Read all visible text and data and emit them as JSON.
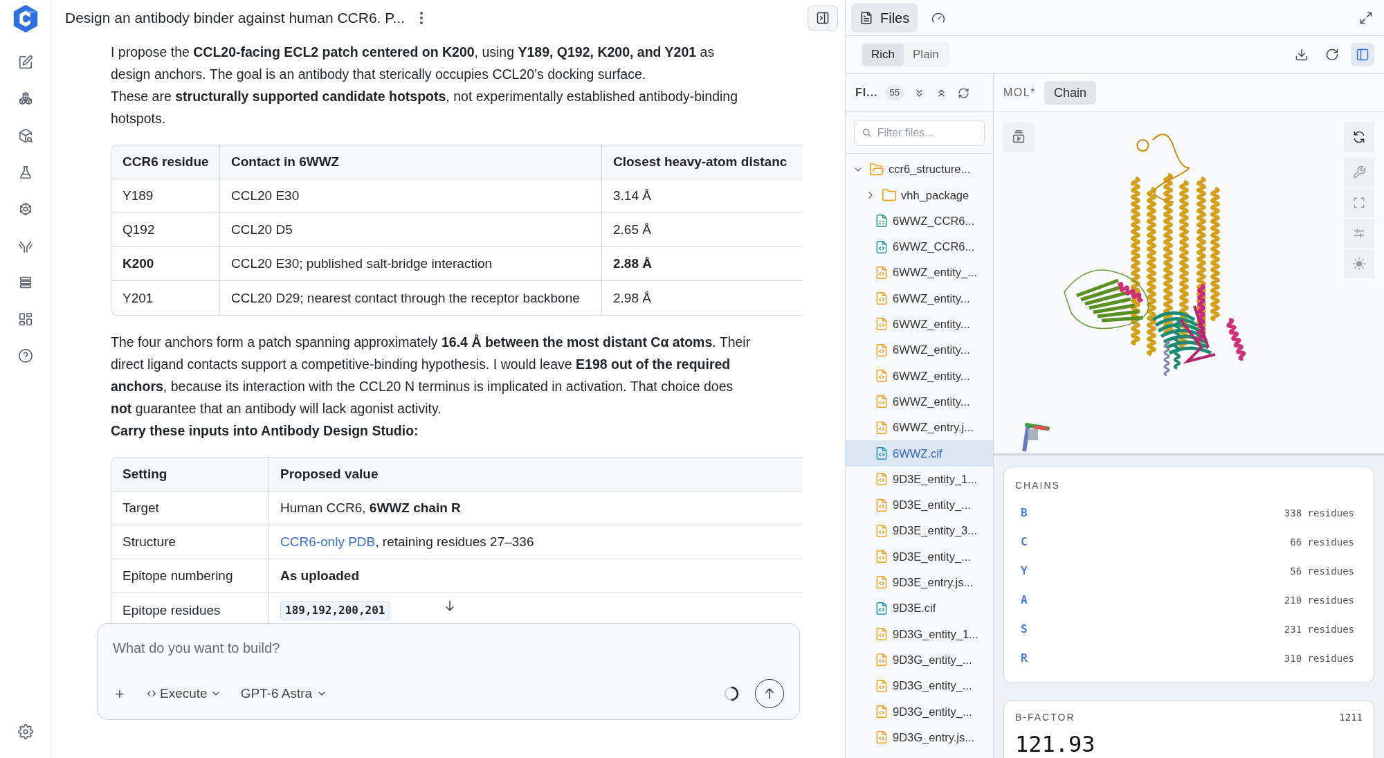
{
  "chat": {
    "title": "Design an antibody binder against human CCR6. P...",
    "intro": [
      "I propose the **CCL20-facing ECL2 patch centered on K200**, using **Y189, Q192, K200, and Y201** as design anchors. The goal is an antibody that sterically occupies CCL20’s docking surface.",
      "These are **structurally supported candidate hotspots**, not experimentally established antibody-binding hotspots."
    ],
    "contacts_table": {
      "columns": [
        "CCR6 residue",
        "Contact in 6WWZ",
        "Closest heavy-atom distanc"
      ],
      "rows": [
        {
          "residue": "Y189",
          "contact": "CCL20 E30",
          "distance": "3.14 Å",
          "highlighted": false
        },
        {
          "residue": "Q192",
          "contact": "CCL20 D5",
          "distance": "2.65 Å",
          "highlighted": false
        },
        {
          "residue": "K200",
          "contact": "CCL20 E30; published salt-bridge interaction",
          "distance": "2.88 Å",
          "highlighted": true
        },
        {
          "residue": "Y201",
          "contact": "CCL20 D29; nearest contact through the receptor backbone",
          "distance": "2.98 Å",
          "highlighted": false
        }
      ]
    },
    "analysis": "The four anchors form a patch spanning approximately **16.4 Å between the most distant Cα atoms**. Their direct ligand contacts support a competitive-binding hypothesis. I would leave **E198 out of the required anchors**, because its interaction with the CCL20 N terminus is implicated in activation. That choice does **not** guarantee that an antibody will lack agonist activity.",
    "carry_heading": "Carry these inputs into Antibody Design Studio:",
    "settings_table": {
      "columns": [
        "Setting",
        "Proposed value"
      ],
      "rows": [
        {
          "setting": "Target",
          "kind": "text",
          "value": "Human CCR6, **6WWZ chain R**"
        },
        {
          "setting": "Structure",
          "kind": "link",
          "link": "CCR6-only PDB",
          "value": ", retaining residues 27–336"
        },
        {
          "setting": "Epitope numbering",
          "kind": "bold",
          "value": "As uploaded"
        },
        {
          "setting": "Epitope residues",
          "kind": "code",
          "value": "189,192,200,201"
        }
      ]
    },
    "composer": {
      "placeholder": "What do you want to build?",
      "plus": "+",
      "mode": "Execute",
      "model": "GPT-6 Astra"
    }
  },
  "panel": {
    "tabs": [
      {
        "label": "Files",
        "kind": "files",
        "selected": true
      },
      {
        "kind": "gauge",
        "selected": false
      }
    ],
    "view_modes": [
      {
        "label": "Rich",
        "selected": true
      },
      {
        "label": "Plain",
        "selected": false
      }
    ],
    "sidebar_toggle_on": true,
    "tree_header": {
      "title": "FI...",
      "count": "55"
    },
    "filter_placeholder": "Filter files...",
    "tree": [
      {
        "label": "ccr6_structure...",
        "kind": "folder",
        "expanded": true,
        "selected": false,
        "children": [
          {
            "label": "vhh_package",
            "kind": "folder",
            "expanded": false,
            "selected": false
          },
          {
            "label": "6WWZ_CCR6...",
            "kind": "sheet",
            "selected": false
          },
          {
            "label": "6WWZ_CCR6...",
            "kind": "cif",
            "selected": false
          },
          {
            "label": "6WWZ_entity_...",
            "kind": "json",
            "selected": false
          },
          {
            "label": "6WWZ_entity...",
            "kind": "json",
            "selected": false
          },
          {
            "label": "6WWZ_entity...",
            "kind": "json",
            "selected": false
          },
          {
            "label": "6WWZ_entity...",
            "kind": "json",
            "selected": false
          },
          {
            "label": "6WWZ_entity...",
            "kind": "json",
            "selected": false
          },
          {
            "label": "6WWZ_entity...",
            "kind": "json",
            "selected": false
          },
          {
            "label": "6WWZ_entry.j...",
            "kind": "json",
            "selected": false
          },
          {
            "label": "6WWZ.cif",
            "kind": "cif",
            "selected": true
          },
          {
            "label": "9D3E_entity_1...",
            "kind": "json",
            "selected": false
          },
          {
            "label": "9D3E_entity_...",
            "kind": "json",
            "selected": false
          },
          {
            "label": "9D3E_entity_3...",
            "kind": "json",
            "selected": false
          },
          {
            "label": "9D3E_entity_...",
            "kind": "json",
            "selected": false
          },
          {
            "label": "9D3E_entry.js...",
            "kind": "json",
            "selected": false
          },
          {
            "label": "9D3E.cif",
            "kind": "cif",
            "selected": false
          },
          {
            "label": "9D3G_entity_1...",
            "kind": "json",
            "selected": false
          },
          {
            "label": "9D3G_entity_...",
            "kind": "json",
            "selected": false
          },
          {
            "label": "9D3G_entity_...",
            "kind": "json",
            "selected": false
          },
          {
            "label": "9D3G_entity_...",
            "kind": "json",
            "selected": false
          },
          {
            "label": "9D3G_entry.js...",
            "kind": "json",
            "selected": false
          }
        ]
      }
    ],
    "viewer": {
      "label": "MOL*",
      "color_mode": "Chain"
    },
    "chains": {
      "title": "CHAINS",
      "items": [
        {
          "id": "B",
          "residues": "338 residues"
        },
        {
          "id": "C",
          "residues": "66 residues"
        },
        {
          "id": "Y",
          "residues": "56 residues"
        },
        {
          "id": "A",
          "residues": "210 residues"
        },
        {
          "id": "S",
          "residues": "231 residues"
        },
        {
          "id": "R",
          "residues": "310 residues"
        }
      ]
    },
    "bfactor": {
      "title": "B-FACTOR",
      "count": "1211",
      "value": "121.93"
    }
  }
}
